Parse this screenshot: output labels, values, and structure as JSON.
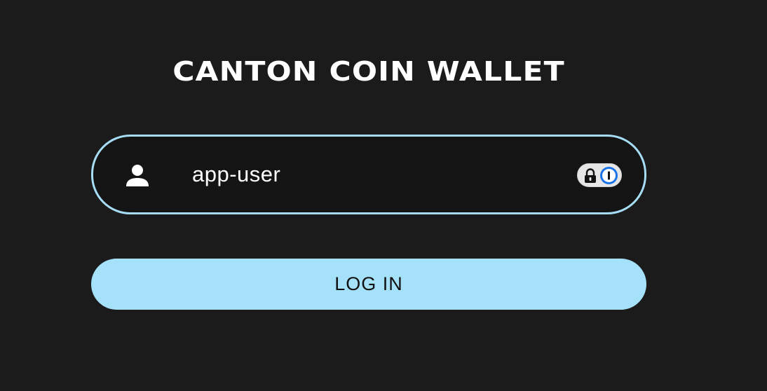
{
  "app": {
    "title": "CANTON COIN WALLET"
  },
  "login_form": {
    "username_value": "app-user",
    "login_label": "LOG IN"
  },
  "icons": {
    "user": "user-icon",
    "password_manager": "password-manager-icon",
    "lock": "lock-icon"
  },
  "colors": {
    "background": "#1b1b1b",
    "accent": "#a6e1fa",
    "field_border": "#a6ddf5",
    "text": "#ffffff",
    "button_text": "#111111"
  }
}
